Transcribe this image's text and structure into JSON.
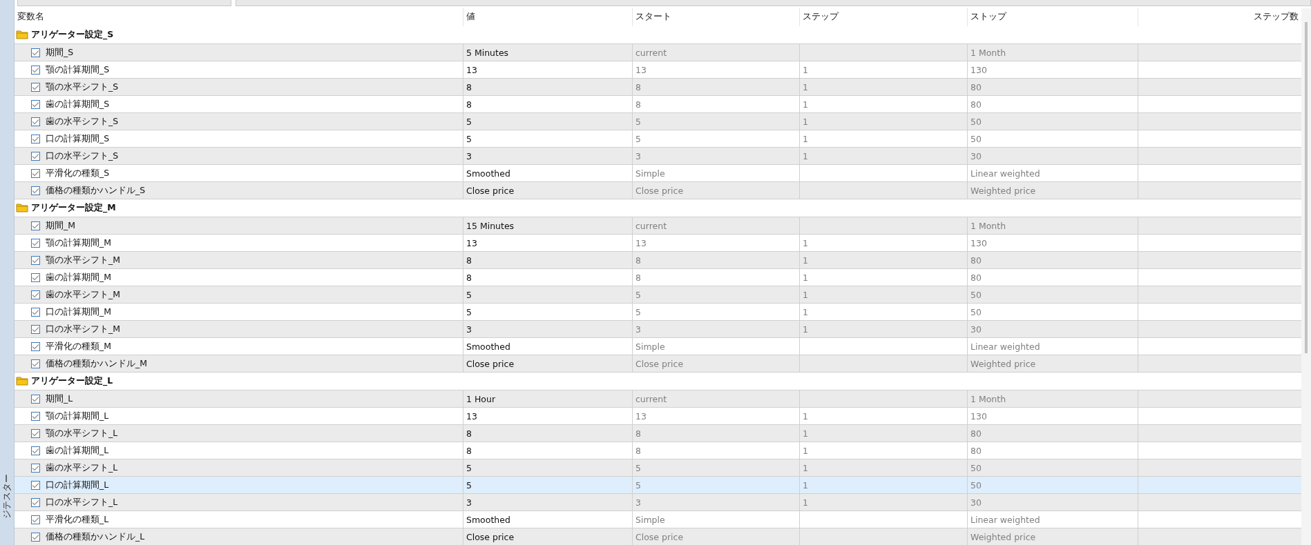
{
  "side_panel": {
    "label": "ジテスター"
  },
  "columns": [
    "変数名",
    "値",
    "スタート",
    "ステップ",
    "ストップ",
    "ステップ数"
  ],
  "groups": [
    {
      "name": "アリゲーター設定_S",
      "params": [
        {
          "name": "期間_S",
          "value": "5 Minutes",
          "start": "current",
          "stop": "1 Month",
          "checked": true,
          "selected": false
        },
        {
          "name": "顎の計算期間_S",
          "value": "13",
          "start": "13",
          "step": "1",
          "stop": "130",
          "checked": true,
          "selected": false
        },
        {
          "name": "顎の水平シフト_S",
          "value": "8",
          "start": "8",
          "step": "1",
          "stop": "80",
          "checked": true,
          "selected": false
        },
        {
          "name": "歯の計算期間_S",
          "value": "8",
          "start": "8",
          "step": "1",
          "stop": "80",
          "checked": true,
          "selected": false
        },
        {
          "name": "歯の水平シフト_S",
          "value": "5",
          "start": "5",
          "step": "1",
          "stop": "50",
          "checked": true,
          "selected": false
        },
        {
          "name": "口の計算期間_S",
          "value": "5",
          "start": "5",
          "step": "1",
          "stop": "50",
          "checked": true,
          "selected": false
        },
        {
          "name": "口の水平シフト_S",
          "value": "3",
          "start": "3",
          "step": "1",
          "stop": "30",
          "checked": true,
          "selected": false
        },
        {
          "name": "平滑化の種類_S",
          "value": "Smoothed",
          "start": "Simple",
          "stop": "Linear weighted",
          "checked": true,
          "selected": false
        },
        {
          "name": "価格の種類かハンドル_S",
          "value": "Close price",
          "start": "Close price",
          "stop": "Weighted price",
          "checked": true,
          "selected": false
        }
      ]
    },
    {
      "name": "アリゲーター設定_M",
      "params": [
        {
          "name": "期間_M",
          "value": "15 Minutes",
          "start": "current",
          "stop": "1 Month",
          "checked": true,
          "selected": false
        },
        {
          "name": "顎の計算期間_M",
          "value": "13",
          "start": "13",
          "step": "1",
          "stop": "130",
          "checked": true,
          "selected": false
        },
        {
          "name": "顎の水平シフト_M",
          "value": "8",
          "start": "8",
          "step": "1",
          "stop": "80",
          "checked": true,
          "selected": false
        },
        {
          "name": "歯の計算期間_M",
          "value": "8",
          "start": "8",
          "step": "1",
          "stop": "80",
          "checked": true,
          "selected": false
        },
        {
          "name": "歯の水平シフト_M",
          "value": "5",
          "start": "5",
          "step": "1",
          "stop": "50",
          "checked": true,
          "selected": false
        },
        {
          "name": "口の計算期間_M",
          "value": "5",
          "start": "5",
          "step": "1",
          "stop": "50",
          "checked": true,
          "selected": false
        },
        {
          "name": "口の水平シフト_M",
          "value": "3",
          "start": "3",
          "step": "1",
          "stop": "30",
          "checked": true,
          "selected": false
        },
        {
          "name": "平滑化の種類_M",
          "value": "Smoothed",
          "start": "Simple",
          "stop": "Linear weighted",
          "checked": true,
          "selected": false
        },
        {
          "name": "価格の種類かハンドル_M",
          "value": "Close price",
          "start": "Close price",
          "stop": "Weighted price",
          "checked": true,
          "selected": false
        }
      ]
    },
    {
      "name": "アリゲーター設定_L",
      "params": [
        {
          "name": "期間_L",
          "value": "1 Hour",
          "start": "current",
          "stop": "1 Month",
          "checked": true,
          "selected": false
        },
        {
          "name": "顎の計算期間_L",
          "value": "13",
          "start": "13",
          "step": "1",
          "stop": "130",
          "checked": true,
          "selected": false
        },
        {
          "name": "顎の水平シフト_L",
          "value": "8",
          "start": "8",
          "step": "1",
          "stop": "80",
          "checked": true,
          "selected": false
        },
        {
          "name": "歯の計算期間_L",
          "value": "8",
          "start": "8",
          "step": "1",
          "stop": "80",
          "checked": true,
          "selected": false
        },
        {
          "name": "歯の水平シフト_L",
          "value": "5",
          "start": "5",
          "step": "1",
          "stop": "50",
          "checked": true,
          "selected": false
        },
        {
          "name": "口の計算期間_L",
          "value": "5",
          "start": "5",
          "step": "1",
          "stop": "50",
          "checked": true,
          "selected": true
        },
        {
          "name": "口の水平シフト_L",
          "value": "3",
          "start": "3",
          "step": "1",
          "stop": "30",
          "checked": true,
          "selected": false
        },
        {
          "name": "平滑化の種類_L",
          "value": "Smoothed",
          "start": "Simple",
          "stop": "Linear weighted",
          "checked": true,
          "selected": false
        },
        {
          "name": "価格の種類かハンドル_L",
          "value": "Close price",
          "start": "Close price",
          "stop": "Weighted price",
          "checked": true,
          "selected": false
        }
      ]
    }
  ]
}
